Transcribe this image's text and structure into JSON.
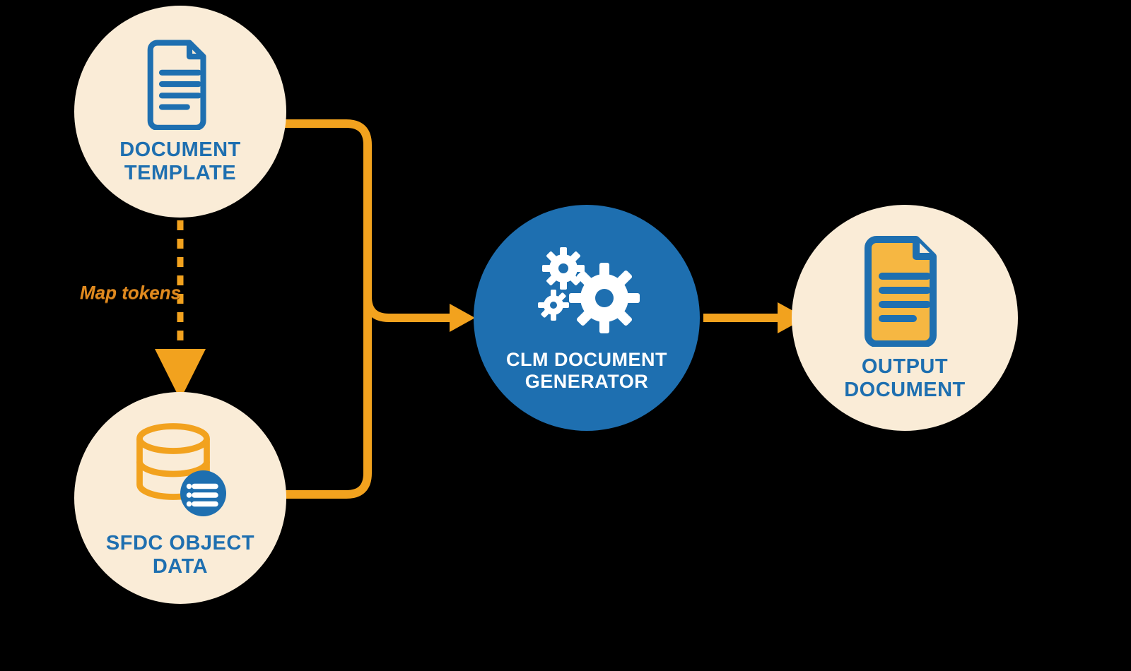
{
  "nodes": {
    "doc_template": {
      "label": "DOCUMENT\nTEMPLATE"
    },
    "sfdc_data": {
      "label": "SFDC OBJECT\nDATA"
    },
    "generator": {
      "label": "CLM DOCUMENT\nGENERATOR"
    },
    "output_doc": {
      "label": "OUTPUT\nDOCUMENT"
    }
  },
  "edges": {
    "map_tokens": {
      "label": "Map tokens"
    }
  },
  "colors": {
    "cream": "#faecd7",
    "blue": "#1e6fb0",
    "orange": "#f2a21e",
    "white": "#ffffff"
  }
}
